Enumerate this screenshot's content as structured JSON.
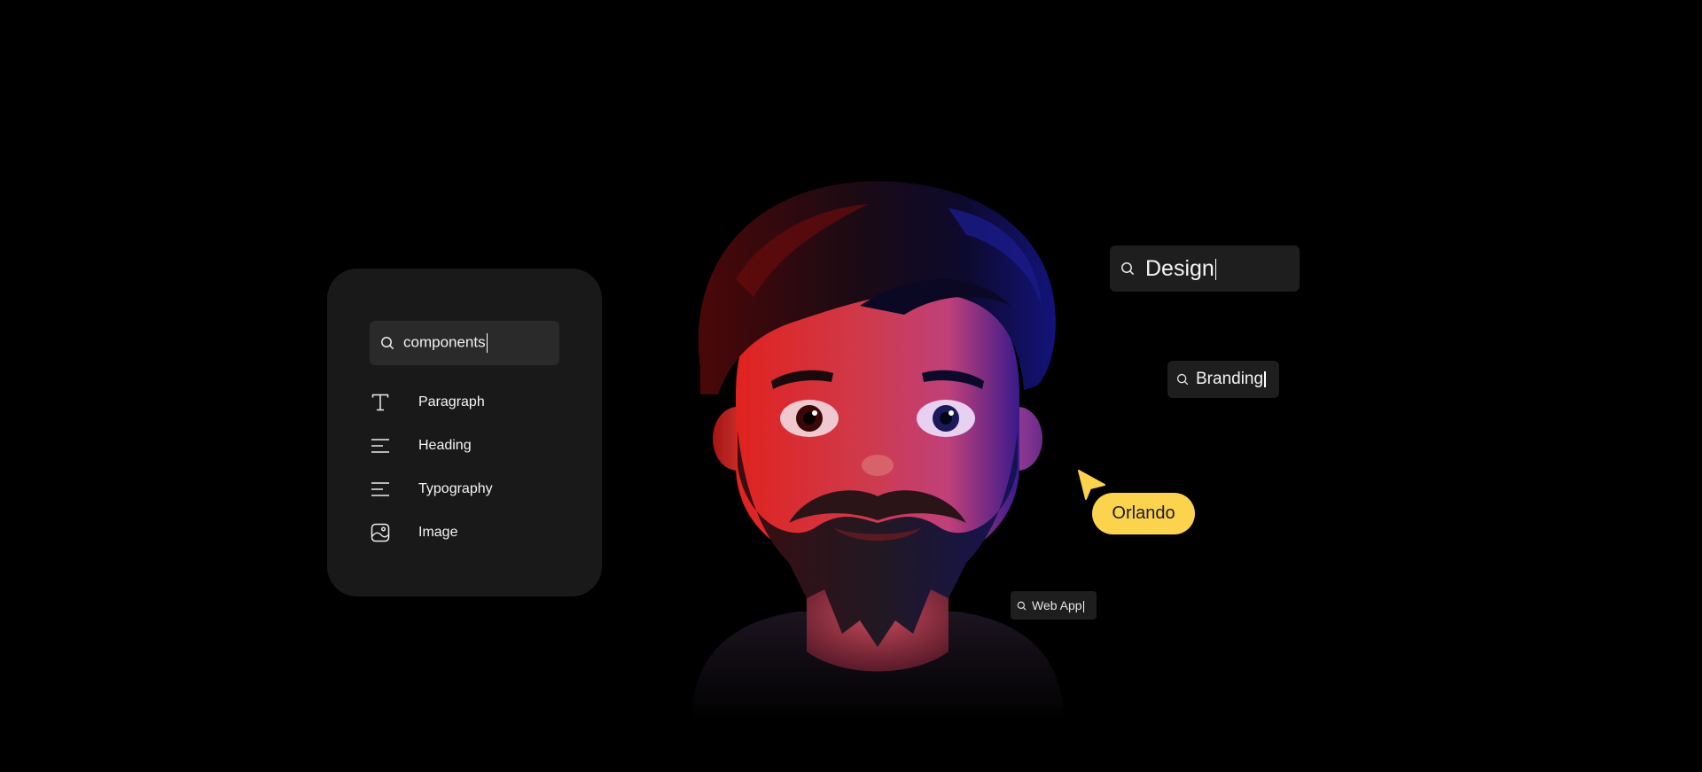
{
  "components_panel": {
    "search": {
      "value": "components"
    },
    "items": [
      {
        "label": "Paragraph",
        "icon": "text-t-icon"
      },
      {
        "label": "Heading",
        "icon": "lines-icon"
      },
      {
        "label": "Typography",
        "icon": "lines-icon"
      },
      {
        "label": "Image",
        "icon": "image-icon"
      }
    ]
  },
  "floating_searches": {
    "design": {
      "value": "Design"
    },
    "branding": {
      "value": "Branding"
    },
    "web_app": {
      "value": "Web App"
    }
  },
  "cursor": {
    "name": "Orlando",
    "color": "#fcd34d"
  },
  "colors": {
    "background": "#000000",
    "panel": "#191919",
    "input": "#2a2a2a",
    "chip": "#1e1e1e",
    "avatar_red": "#d4141c",
    "avatar_blue": "#1a1aa8"
  }
}
